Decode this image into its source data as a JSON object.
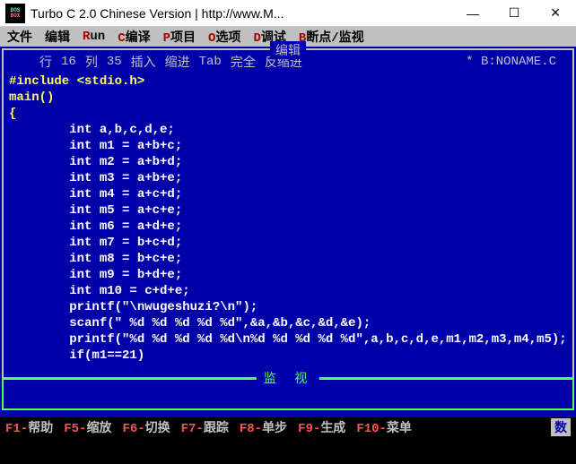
{
  "titlebar": {
    "icon_top": "DOS",
    "icon_bottom": "BOX",
    "text": "Turbo C 2.0 Chinese Version | http://www.M...",
    "min": "—",
    "max": "☐",
    "close": "×"
  },
  "menu": {
    "file": "文件",
    "edit": "编辑",
    "run_key": "R",
    "run_lbl": "un",
    "compile_key": "C",
    "compile_lbl": "编译",
    "project_key": "P",
    "project_lbl": "项目",
    "option_key": "O",
    "option_lbl": "选项",
    "debug_key": "D",
    "debug_lbl": "调试",
    "break_key": "B",
    "break_lbl": "断点/监视"
  },
  "editor": {
    "frame_title": "编辑",
    "row_label": "行",
    "row_val": "16",
    "col_label": "列",
    "col_val": "35",
    "insert": "插入",
    "indent": "缩进",
    "tab": "Tab",
    "full": "完全",
    "unindent": "反缩进",
    "file_marker": "* B:NONAME.C"
  },
  "code": [
    "#include <stdio.h>",
    "main()",
    "{",
    "        int a,b,c,d,e;",
    "        int m1 = a+b+c;",
    "        int m2 = a+b+d;",
    "        int m3 = a+b+e;",
    "        int m4 = a+c+d;",
    "        int m5 = a+c+e;",
    "        int m6 = a+d+e;",
    "        int m7 = b+c+d;",
    "        int m8 = b+c+e;",
    "        int m9 = b+d+e;",
    "        int m10 = c+d+e;",
    "        printf(\"\\nwugeshuzi?\\n\");",
    "        scanf(\" %d %d %d %d %d\",&a,&b,&c,&d,&e);",
    "        printf(\"%d %d %d %d %d\\n%d %d %d %d %d\",a,b,c,d,e,m1,m2,m3,m4,m5);",
    "        if(m1==21)"
  ],
  "watch": {
    "title": "监 视"
  },
  "fnkeys": {
    "f1": "F1-",
    "f1l": "帮助",
    "f5": "F5-",
    "f5l": "缩放",
    "f6": "F6-",
    "f6l": "切换",
    "f7": "F7-",
    "f7l": "跟踪",
    "f8": "F8-",
    "f8l": "单步",
    "f9": "F9-",
    "f9l": "生成",
    "f10": "F10-",
    "f10l": "菜单",
    "indicator": "数"
  }
}
